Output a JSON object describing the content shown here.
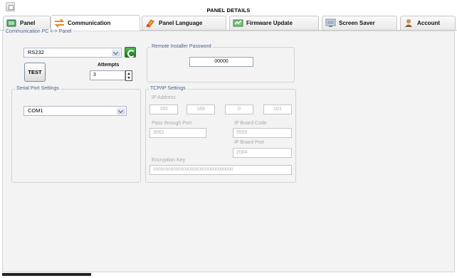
{
  "window": {
    "title": "PANEL DETAILS"
  },
  "tabs": [
    {
      "label": "Panel",
      "icon": "panel-icon"
    },
    {
      "label": "Communication",
      "icon": "communication-arrows-icon",
      "active": true
    },
    {
      "label": "Panel Language",
      "icon": "panel-language-icon"
    },
    {
      "label": "Firmware Update",
      "icon": "firmware-update-icon"
    },
    {
      "label": "Screen Saver",
      "icon": "screen-saver-icon"
    },
    {
      "label": "Account",
      "icon": "account-icon"
    }
  ],
  "communication": {
    "group_label": "Communication PC <-> Panel",
    "port_type": {
      "value": "RS232"
    },
    "test_button": "TEST",
    "attempts": {
      "label": "Attempts",
      "value": "3"
    },
    "remote_installer": {
      "label": "Remote Installer Password",
      "value": "00000"
    },
    "serial_port": {
      "label": "Serial Port Settings",
      "value": "COM1"
    },
    "tcpip": {
      "label": "TCP/IP Settings",
      "ip_label": "IP Address",
      "ip": [
        "192",
        "168",
        "0",
        "101"
      ],
      "pass_through_label": "Pass through Port",
      "pass_through_value": "3062",
      "board_code_label": "IP Board Code",
      "board_code_value": "5555",
      "board_port_label": "IP Board Port",
      "board_port_value": "2004",
      "encryption_label": "Encryption Key",
      "encryption_value": "00000000000000000000000000000000"
    }
  },
  "colors": {
    "legend_text": "#4b5f8c",
    "panel_background": "#f3f3f3",
    "refresh_button": "#2e9a2e",
    "disabled_text": "#a8a8a8"
  }
}
